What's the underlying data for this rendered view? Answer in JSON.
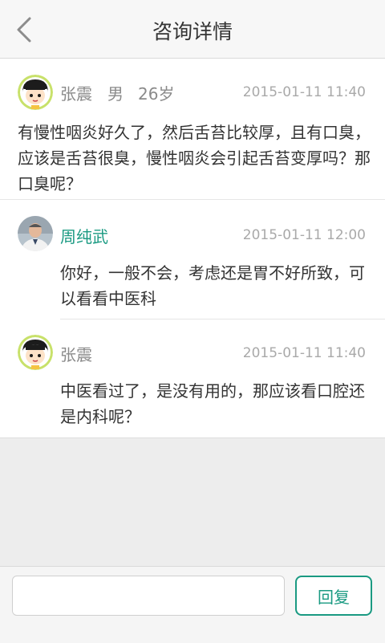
{
  "header": {
    "title": "咨询详情",
    "back_icon": "chevron-left-icon"
  },
  "question": {
    "user_name": "张震",
    "gender": "男",
    "age": "26岁",
    "time": "2015-01-11 11:40",
    "text": "有慢性咽炎好久了，然后舌苔比较厚，且有口臭，应该是舌苔很臭，慢性咽炎会引起舌苔变厚吗？那口臭呢？"
  },
  "replies": [
    {
      "name": "周纯武",
      "time": "2015-01-11 12:00",
      "text": "你好，一般不会，考虑还是胃不好所致，可以看看中医科",
      "name_color": "#1a9a82"
    },
    {
      "name": "张震",
      "time": "2015-01-11 11:40",
      "text": "中医看过了，是没有用的，那应该看口腔还是内科呢？",
      "name_color": "#8a8a8a"
    }
  ],
  "reply_bar": {
    "input_placeholder": "",
    "button_label": "回复"
  },
  "colors": {
    "accent": "#1a9a82"
  }
}
